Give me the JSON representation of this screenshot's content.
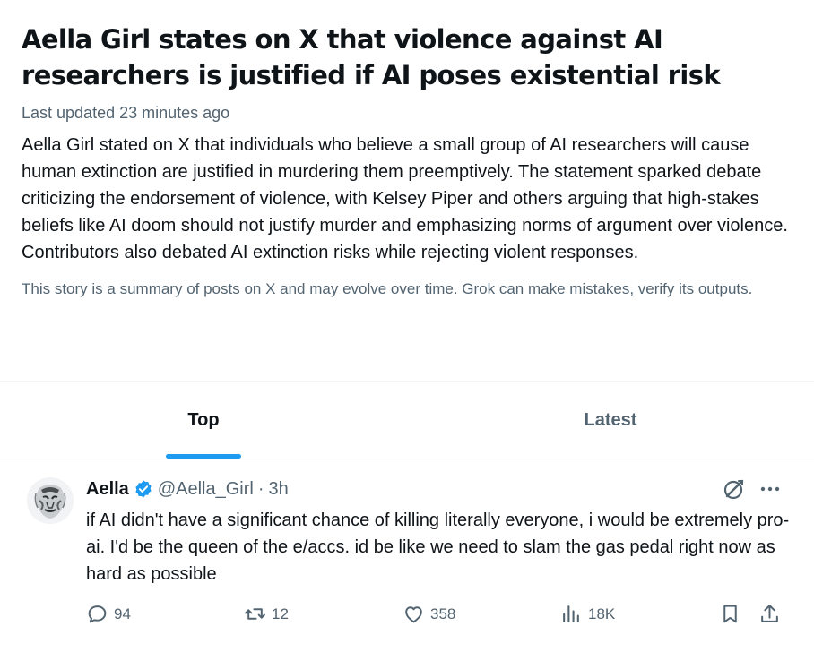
{
  "story": {
    "headline": "Aella Girl states on X that violence against AI researchers is justified if AI poses existential risk",
    "updated": "Last updated 23 minutes ago",
    "summary": "Aella Girl stated on X that individuals who believe a small group of AI researchers will cause human extinction are justified in murdering them preemptively. The statement sparked debate criticizing the endorsement of violence, with Kelsey Piper and others arguing that high-stakes beliefs like AI doom should not justify murder and emphasizing norms of argument over violence. Contributors also debated AI extinction risks while rejecting violent responses.",
    "disclaimer": "This story is a summary of posts on X and may evolve over time. Grok can make mistakes, verify its outputs."
  },
  "tabs": [
    {
      "label": "Top",
      "active": true
    },
    {
      "label": "Latest",
      "active": false
    }
  ],
  "post": {
    "author_name": "Aella",
    "handle": "@Aella_Girl",
    "separator": "·",
    "time": "3h",
    "text": "if AI didn't have a significant chance of killing literally everyone, i would be extremely pro-ai. I'd be the queen of the e/accs. id be like we need to slam the gas pedal right now as hard as possible",
    "actions": {
      "replies": "94",
      "reposts": "12",
      "likes": "358",
      "views": "18K"
    }
  },
  "icons": {
    "verified": "verified-badge-icon",
    "grok": "grok-icon",
    "more": "more-icon",
    "reply": "reply-icon",
    "repost": "repost-icon",
    "like": "like-icon",
    "views": "views-icon",
    "bookmark": "bookmark-icon",
    "share": "share-icon"
  },
  "colors": {
    "accent": "#1d9bf0",
    "text": "#0f1419",
    "secondary": "#536471",
    "divider": "#eff3f4"
  }
}
